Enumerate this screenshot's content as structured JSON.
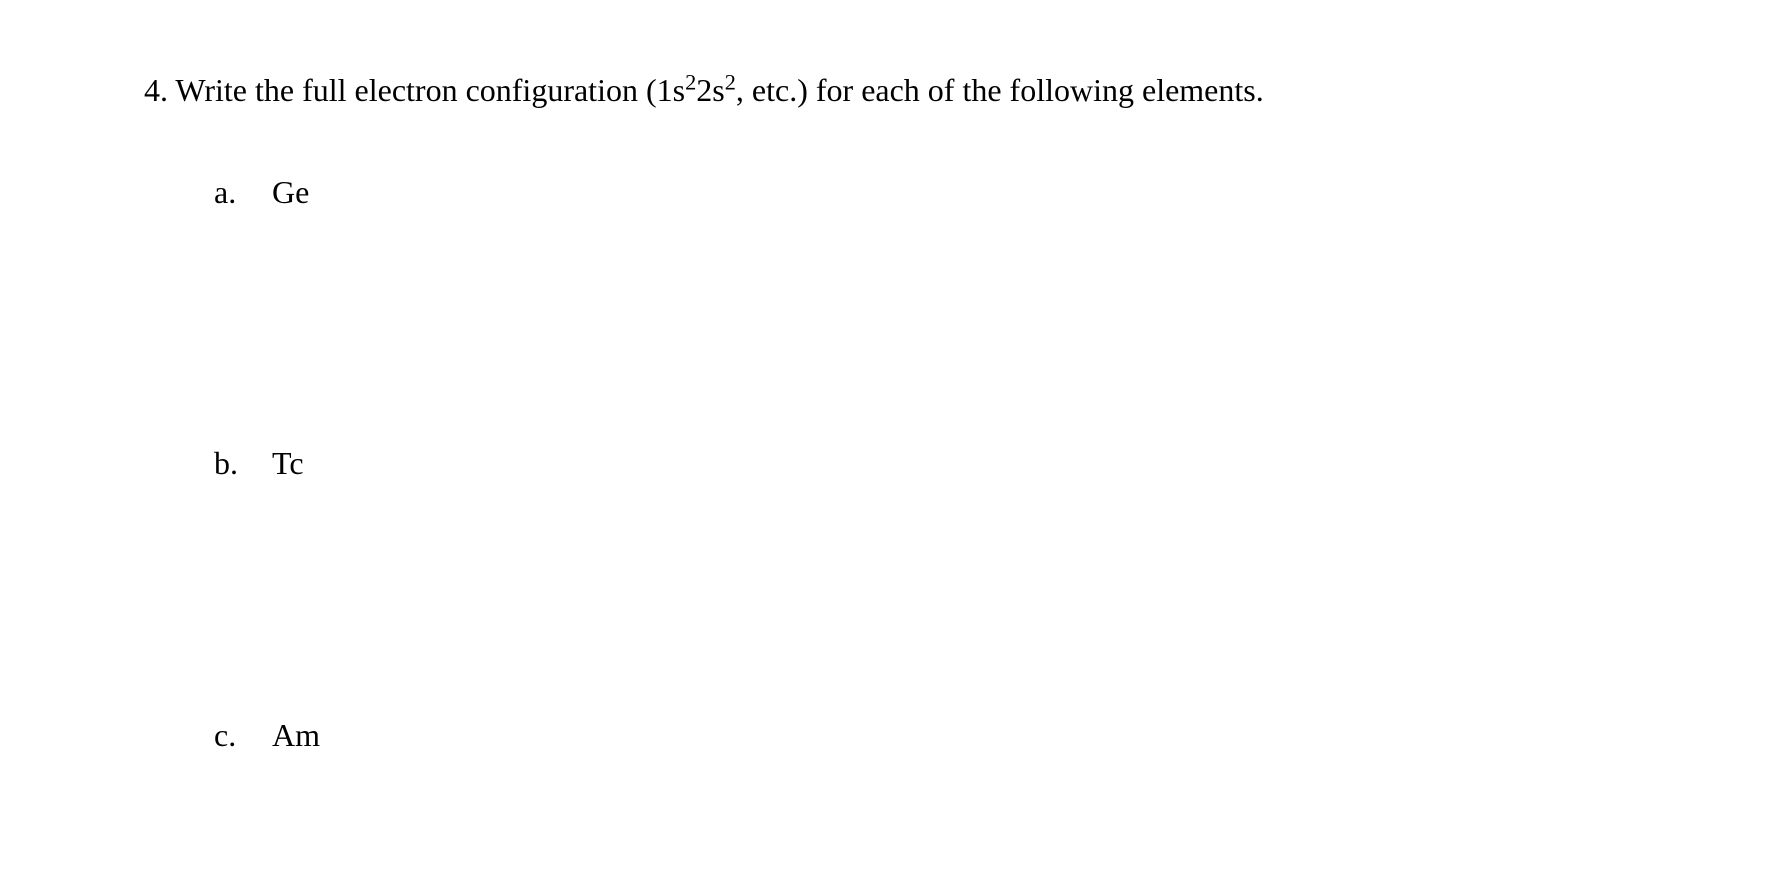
{
  "question": {
    "number": "4.",
    "text_before": " Write the full electron configuration (1s",
    "sup1": "2",
    "text_mid": "2s",
    "sup2": "2",
    "text_after": ", etc.) for each of the following elements."
  },
  "items": [
    {
      "letter": "a.",
      "symbol": "Ge"
    },
    {
      "letter": "b.",
      "symbol": "Tc"
    },
    {
      "letter": "c.",
      "symbol": "Am"
    }
  ]
}
